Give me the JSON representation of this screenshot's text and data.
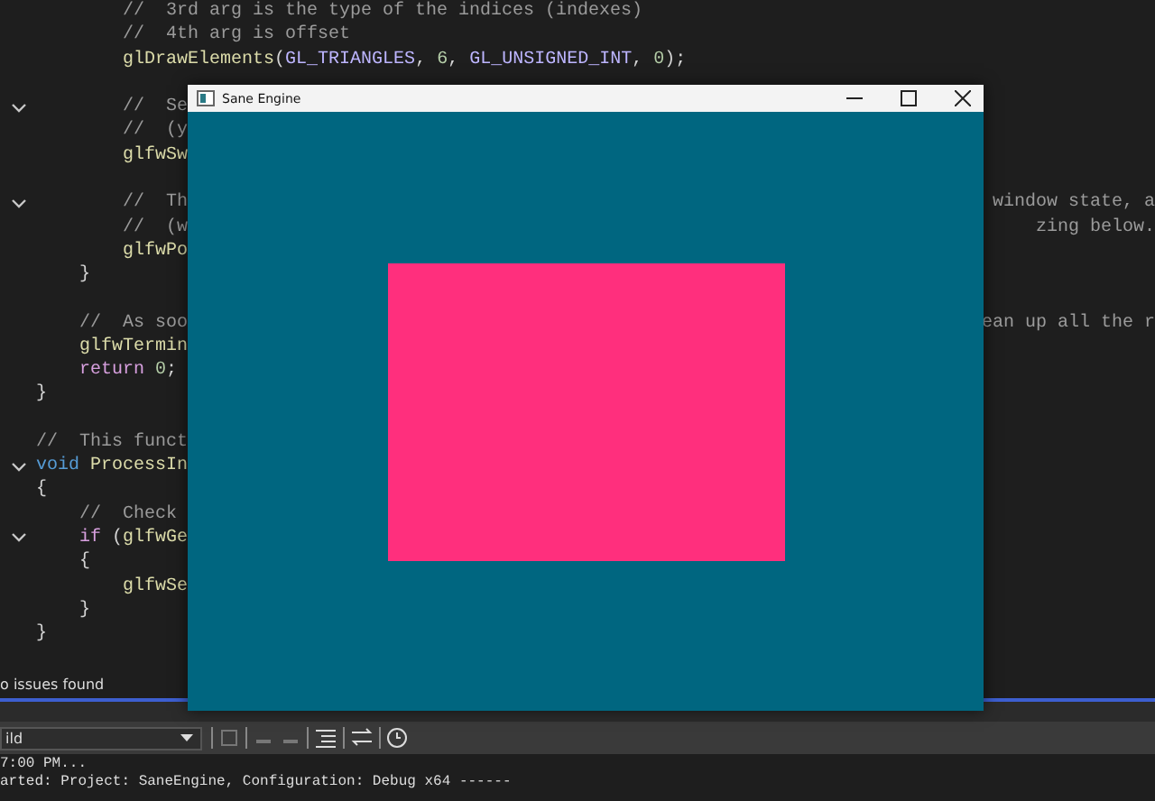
{
  "editor": {
    "lines": [
      {
        "fold": false,
        "segments": [
          {
            "kind": "comment",
            "text": "        //  3rd arg is the type of the indices (indexes)"
          }
        ]
      },
      {
        "fold": false,
        "segments": [
          {
            "kind": "comment",
            "text": "        //  4th arg is offset"
          }
        ]
      },
      {
        "fold": false,
        "segments": [
          {
            "kind": "function",
            "text": "        glDrawElements"
          },
          {
            "kind": "plain",
            "text": "("
          },
          {
            "kind": "macro",
            "text": "GL_TRIANGLES"
          },
          {
            "kind": "plain",
            "text": ","
          },
          {
            "kind": "number",
            "text": " 6"
          },
          {
            "kind": "plain",
            "text": ","
          },
          {
            "kind": "macro",
            "text": " GL_UNSIGNED_INT"
          },
          {
            "kind": "plain",
            "text": ","
          },
          {
            "kind": "number",
            "text": " 0"
          },
          {
            "kind": "plain",
            "text": ");"
          }
        ]
      },
      {
        "fold": false
      },
      {
        "fold": true,
        "segments": [
          {
            "kind": "comment",
            "text": "        //  Se"
          }
        ]
      },
      {
        "fold": false,
        "segments": [
          {
            "kind": "comment",
            "text": "        //  (y"
          }
        ]
      },
      {
        "fold": false,
        "segments": [
          {
            "kind": "function",
            "text": "        glfwSw"
          }
        ]
      },
      {
        "fold": false
      },
      {
        "fold": true,
        "segments": [
          {
            "kind": "comment",
            "text": "        //  Th"
          }
        ],
        "right": "window state, a"
      },
      {
        "fold": false,
        "segments": [
          {
            "kind": "comment",
            "text": "        //  (w"
          }
        ],
        "right": "zing below."
      },
      {
        "fold": false,
        "segments": [
          {
            "kind": "function",
            "text": "        glfwPo"
          }
        ]
      },
      {
        "fold": false,
        "segments": [
          {
            "kind": "plain",
            "text": "    }"
          }
        ]
      },
      {
        "fold": false
      },
      {
        "fold": false,
        "segments": [
          {
            "kind": "comment",
            "text": "    //  As soo"
          }
        ],
        "right": "ean up all the r"
      },
      {
        "fold": false,
        "segments": [
          {
            "kind": "function",
            "text": "    glfwTermin"
          }
        ]
      },
      {
        "fold": false,
        "segments": [
          {
            "kind": "keyword",
            "text": "    return"
          },
          {
            "kind": "number",
            "text": " 0"
          },
          {
            "kind": "plain",
            "text": ";"
          }
        ]
      },
      {
        "fold": false,
        "segments": [
          {
            "kind": "plain",
            "text": "}"
          }
        ]
      },
      {
        "fold": false
      },
      {
        "fold": false,
        "segments": [
          {
            "kind": "comment",
            "text": "//  This funct"
          }
        ]
      },
      {
        "fold": true,
        "segments": [
          {
            "kind": "type",
            "text": "void"
          },
          {
            "kind": "function",
            "text": " ProcessIn"
          }
        ]
      },
      {
        "fold": false,
        "segments": [
          {
            "kind": "plain",
            "text": "{"
          }
        ]
      },
      {
        "fold": false,
        "segments": [
          {
            "kind": "comment",
            "text": "    //  Check"
          }
        ]
      },
      {
        "fold": true,
        "segments": [
          {
            "kind": "keyword",
            "text": "    if"
          },
          {
            "kind": "plain",
            "text": " ("
          },
          {
            "kind": "function",
            "text": "glfwGe"
          }
        ]
      },
      {
        "fold": false,
        "segments": [
          {
            "kind": "plain",
            "text": "    {"
          }
        ]
      },
      {
        "fold": false,
        "segments": [
          {
            "kind": "function",
            "text": "        glfwSe"
          }
        ]
      },
      {
        "fold": false,
        "segments": [
          {
            "kind": "plain",
            "text": "    }"
          }
        ]
      },
      {
        "fold": false,
        "segments": [
          {
            "kind": "plain",
            "text": "}"
          }
        ]
      }
    ]
  },
  "status_bar": {
    "issues": "o issues found"
  },
  "output_panel": {
    "source": "ild",
    "lines": [
      "7:00 PM...",
      "arted: Project: SaneEngine, Configuration: Debug x64 ------"
    ]
  },
  "app_window": {
    "title": "Sane Engine"
  }
}
